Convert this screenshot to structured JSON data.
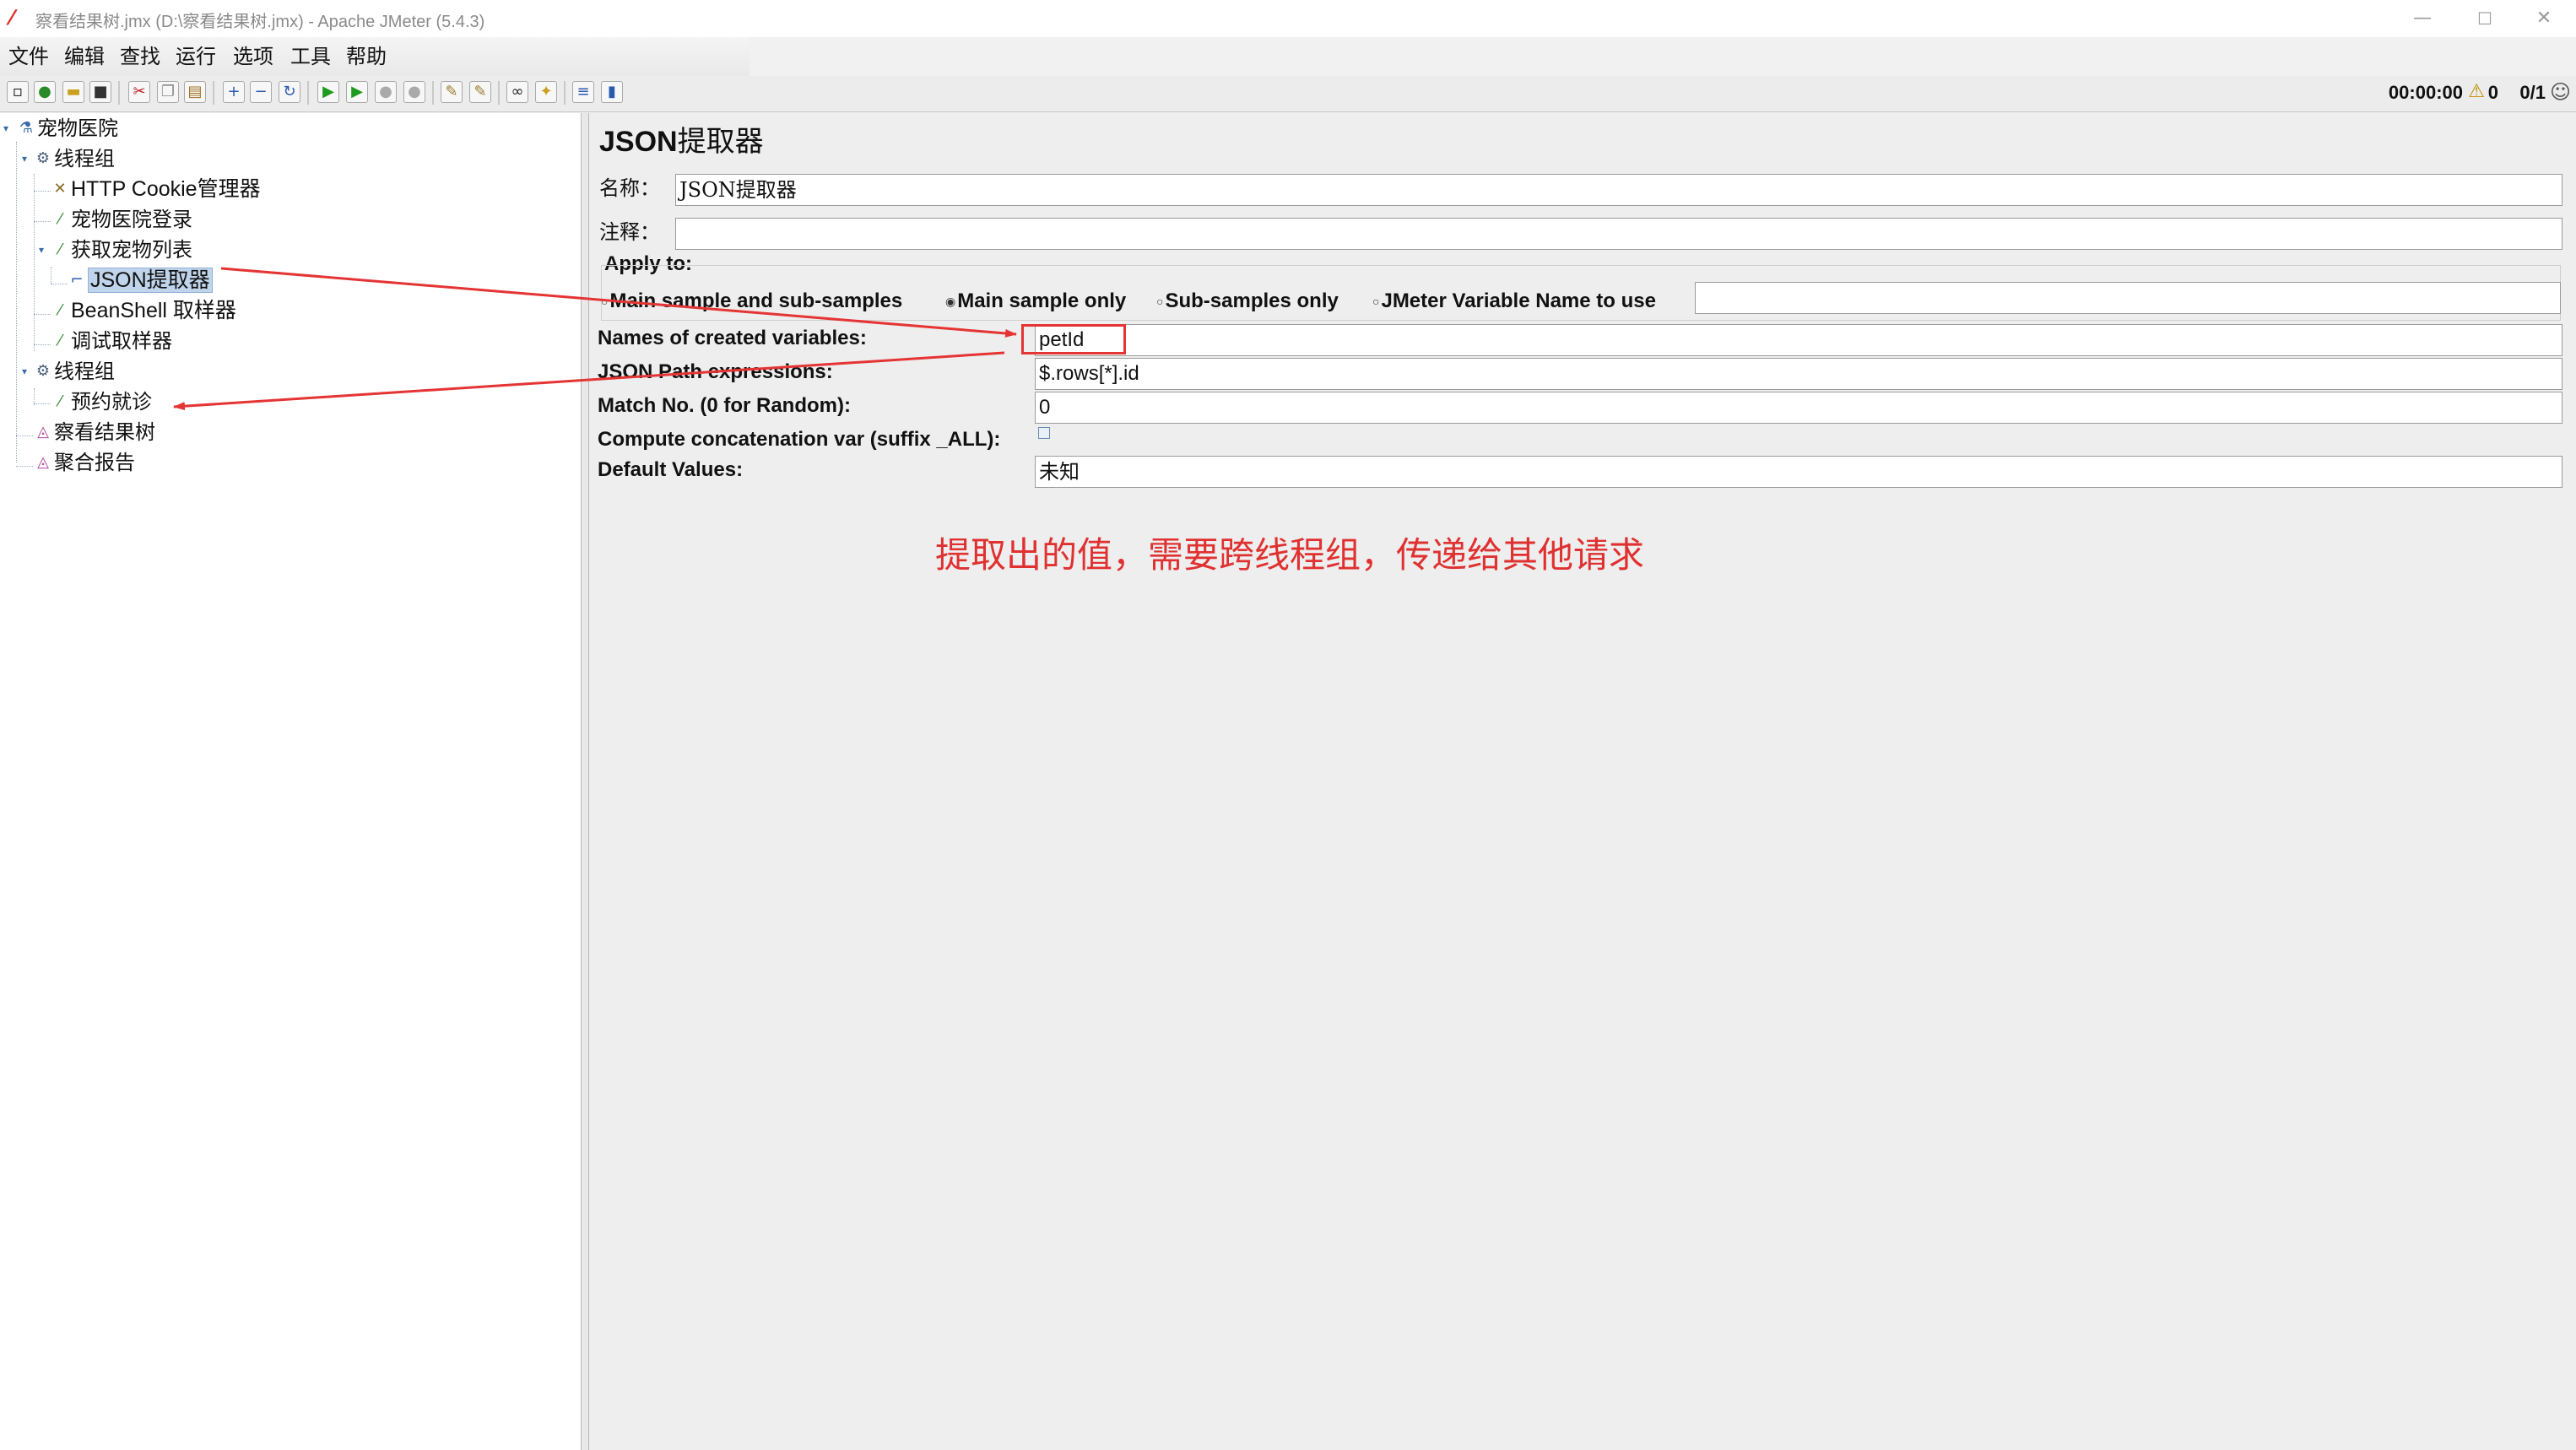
{
  "window": {
    "title": "察看结果树.jmx (D:\\察看结果树.jmx) - Apache JMeter (5.4.3)",
    "minimize": "—",
    "maximize": "☐",
    "close": "✕"
  },
  "menu": [
    "文件",
    "编辑",
    "查找",
    "运行",
    "选项",
    "工具",
    "帮助"
  ],
  "status": {
    "timer": "00:00:00",
    "warnings": "0",
    "threads": "0/1"
  },
  "tree": {
    "root": "宠物医院",
    "group1": "线程组",
    "cookie_manager": "HTTP Cookie管理器",
    "login": "宠物医院登录",
    "get_list": "获取宠物列表",
    "json_extractor": "JSON提取器",
    "beanshell": "BeanShell 取样器",
    "debug": "调试取样器",
    "group2": "线程组",
    "appointment": "预约就诊",
    "view_results": "察看结果树",
    "aggregate": "聚合报告"
  },
  "panel": {
    "title_prefix": "JSON",
    "title_suffix": "提取器",
    "name_label": "名称：",
    "name_value": "JSON提取器",
    "comment_label": "注释：",
    "comment_value": "",
    "apply_to_label": "Apply to:",
    "radio_main_sub": "Main sample and sub-samples",
    "radio_main_only": "Main sample only",
    "radio_sub_only": "Sub-samples only",
    "radio_jmeter_var": "JMeter Variable Name to use",
    "jmeter_var_value": "",
    "vars_label": "Names of created variables:",
    "vars_value": "petId",
    "path_label": "JSON Path expressions:",
    "path_value": "$.rows[*].id",
    "match_label": "Match No. (0 for Random):",
    "match_value": "0",
    "concat_label": "Compute concatenation var (suffix _ALL):",
    "default_label": "Default Values:",
    "default_value": "未知"
  },
  "annotation": "提取出的值，需要跨线程组，传递给其他请求",
  "colors": {
    "annotation": "#e03030",
    "selection": "#c0d4ec",
    "tree_accent": "#3a6ca8"
  }
}
